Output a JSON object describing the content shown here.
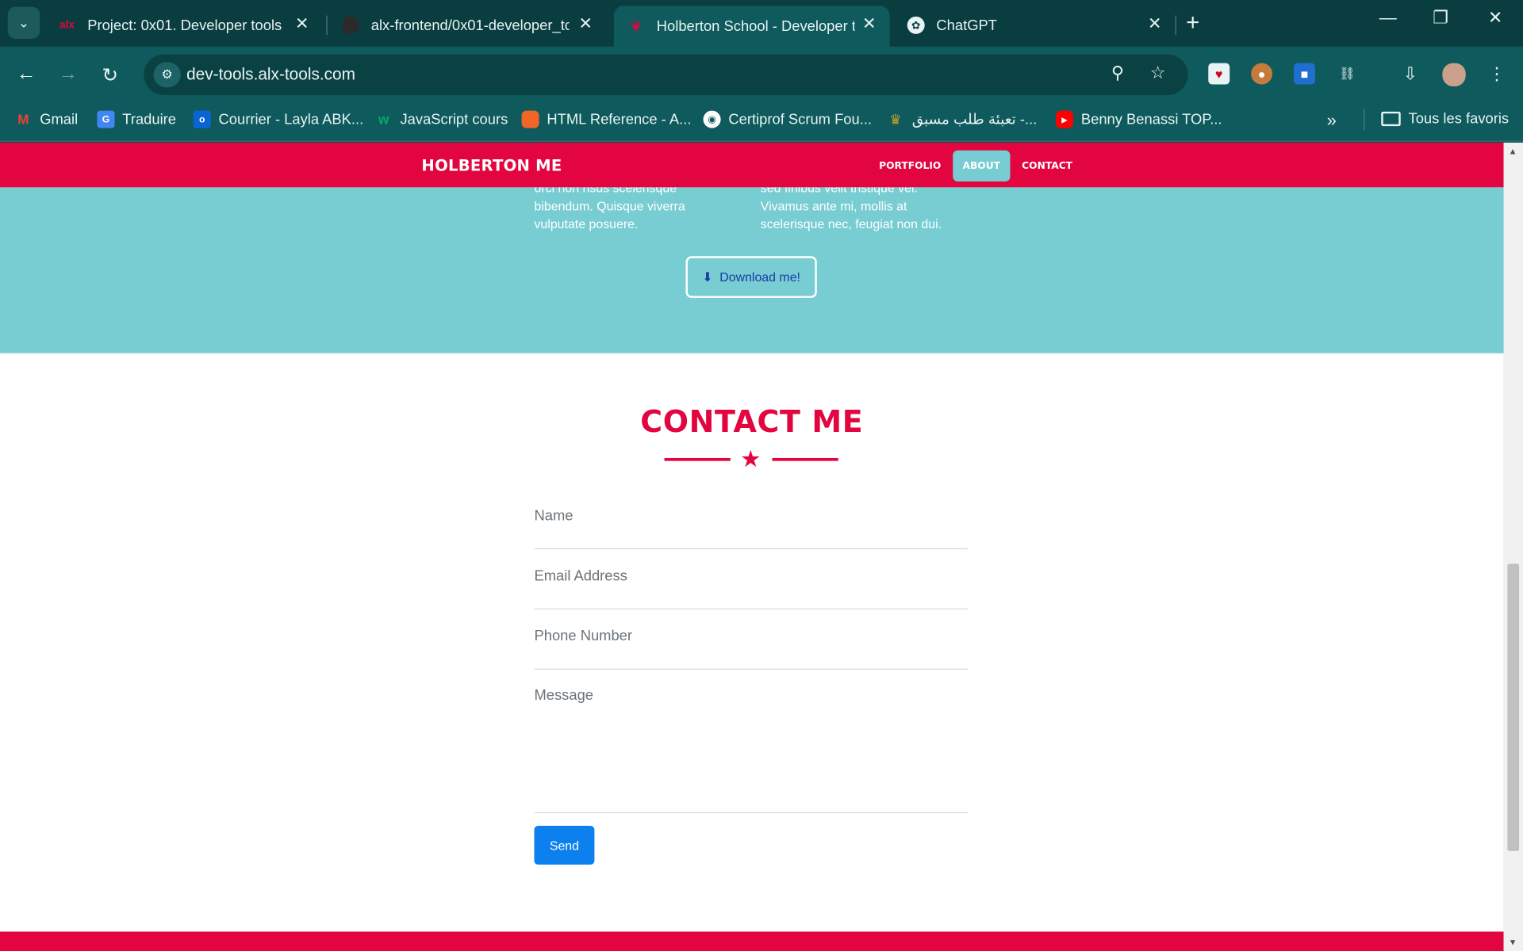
{
  "browser": {
    "tabs": [
      {
        "title": "Project: 0x01. Developer tools |",
        "favicon": "alx-icon",
        "active": false
      },
      {
        "title": "alx-frontend/0x01-developer_tc",
        "favicon": "github-icon",
        "active": false
      },
      {
        "title": "Holberton School - Developer t",
        "favicon": "holberton-icon",
        "active": true
      },
      {
        "title": "ChatGPT",
        "favicon": "chatgpt-icon",
        "active": false
      }
    ],
    "url": "dev-tools.alx-tools.com",
    "bookmarks": [
      {
        "label": "Gmail",
        "icon": "gmail-icon",
        "color": "#ea4335"
      },
      {
        "label": "Traduire",
        "icon": "translate-icon",
        "color": "#4285f4"
      },
      {
        "label": "Courrier - Layla ABK...",
        "icon": "outlook-icon",
        "color": "#0a64d6"
      },
      {
        "label": "JavaScript cours",
        "icon": "w3-icon",
        "color": "#04aa6d"
      },
      {
        "label": "HTML Reference - A...",
        "icon": "html-icon",
        "color": "#f16529"
      },
      {
        "label": "Certiprof Scrum Fou...",
        "icon": "globe-icon",
        "color": "#ffffff"
      },
      {
        "label": "تعبئة طلب مسبق -...",
        "icon": "emblem-icon",
        "color": "#c9a227"
      },
      {
        "label": "Benny Benassi TOP...",
        "icon": "youtube-icon",
        "color": "#ff0000"
      }
    ],
    "all_bookmarks_label": "Tous les favoris"
  },
  "site": {
    "brand": "HOLBERTON ME",
    "nav": [
      {
        "label": "PORTFOLIO",
        "active": false
      },
      {
        "label": "ABOUT",
        "active": true
      },
      {
        "label": "CONTACT",
        "active": false
      }
    ],
    "about": {
      "col1": "orci non risus scelerisque bibendum. Quisque viverra vulputate posuere.",
      "col2": "sed finibus velit tristique vel. Vivamus ante mi, mollis at scelerisque nec, feugiat non dui.",
      "download_label": "Download me!"
    },
    "contact": {
      "title": "CONTACT ME",
      "name_placeholder": "Name",
      "email_placeholder": "Email Address",
      "phone_placeholder": "Phone Number",
      "message_placeholder": "Message",
      "send_label": "Send"
    }
  },
  "colors": {
    "brand_red": "#e3053f",
    "about_teal": "#78cdd3",
    "send_blue": "#0d80ef",
    "browser_dark": "#0a3d3f"
  }
}
